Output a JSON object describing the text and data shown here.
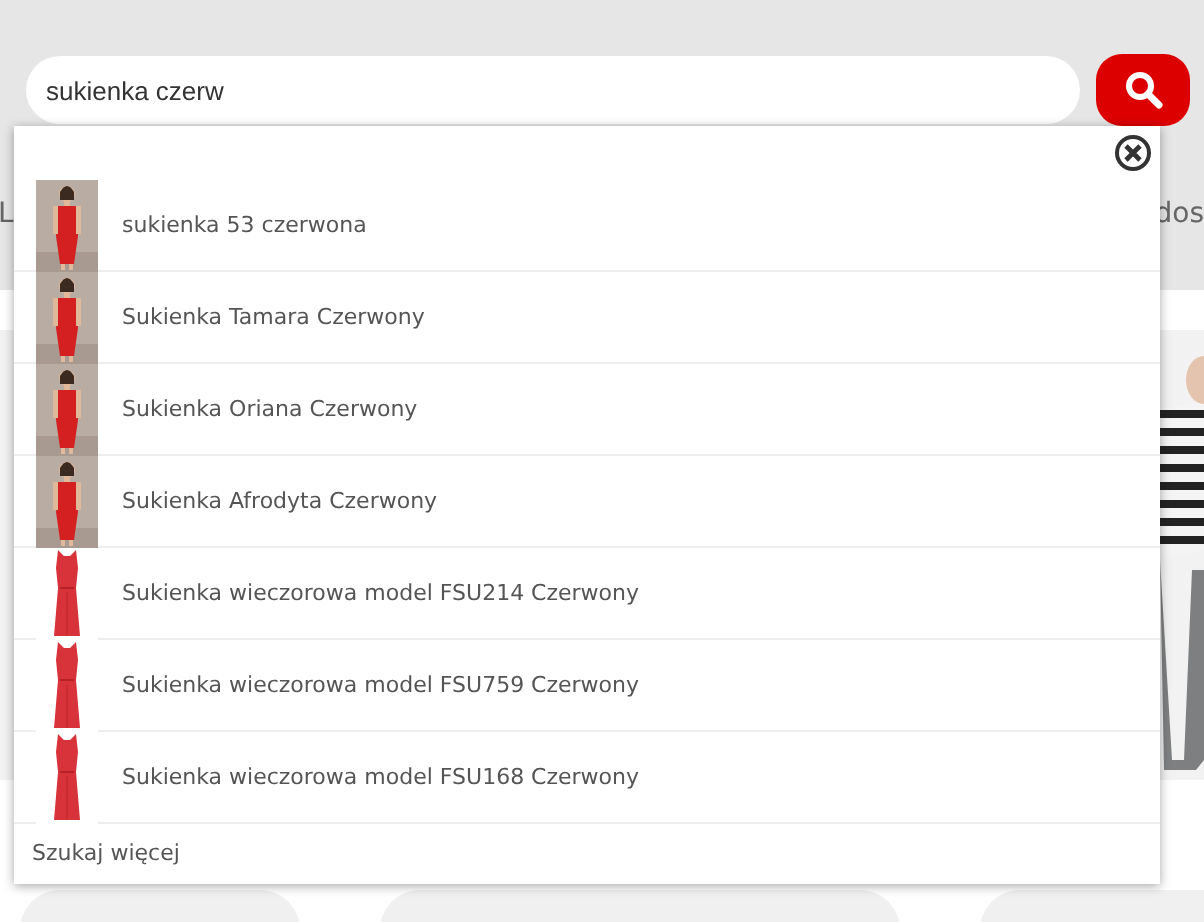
{
  "search": {
    "value": "sukienka czerw"
  },
  "nav": {
    "left_text": "L",
    "right_text": "dos"
  },
  "suggestions": {
    "items": [
      {
        "label": "sukienka 53 czerwona",
        "kind": "model"
      },
      {
        "label": "Sukienka Tamara Czerwony",
        "kind": "model"
      },
      {
        "label": "Sukienka Oriana Czerwony",
        "kind": "model"
      },
      {
        "label": "Sukienka Afrodyta Czerwony",
        "kind": "model"
      },
      {
        "label": "Sukienka wieczorowa model FSU214 Czerwony",
        "kind": "dress"
      },
      {
        "label": "Sukienka wieczorowa model FSU759 Czerwony",
        "kind": "dress"
      },
      {
        "label": "Sukienka wieczorowa model FSU168 Czerwony",
        "kind": "dress"
      }
    ],
    "more_link": "Szukaj więcej"
  }
}
